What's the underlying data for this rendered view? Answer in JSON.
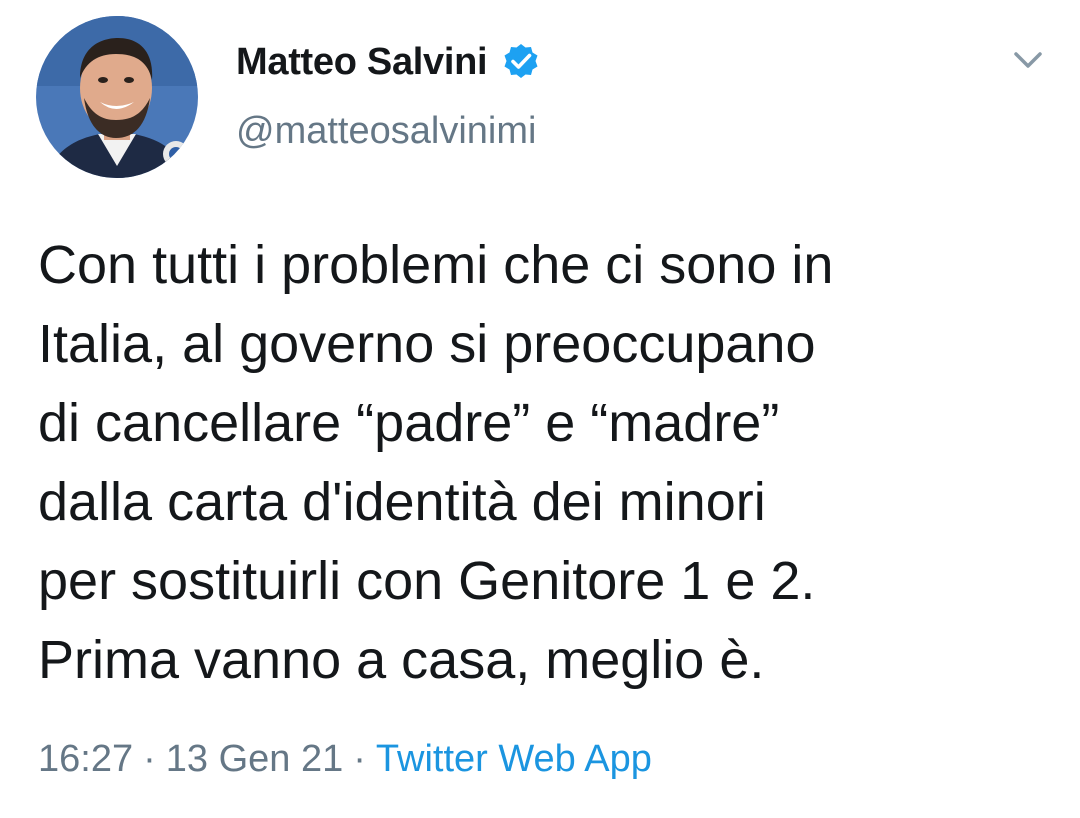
{
  "tweet": {
    "author": {
      "display_name": "Matteo Salvini",
      "handle": "@matteosalvinimi",
      "verified": true
    },
    "text": "Con tutti i problemi che ci sono in\nItalia, al governo si preoccupano\ndi cancellare “padre” e “madre”\ndalla carta d'identità dei minori\nper sostituirli con Genitore 1 e 2.\nPrima vanno a casa, meglio è.",
    "time": "16:27",
    "separator": "·",
    "date": "13 Gen 21",
    "source": "Twitter Web App"
  },
  "icons": {
    "verified": "verified-badge-icon",
    "caret": "chevron-down-icon"
  },
  "colors": {
    "text_primary": "#14171a",
    "text_secondary": "#657786",
    "link": "#1b95e0",
    "verified": "#1da1f2"
  }
}
